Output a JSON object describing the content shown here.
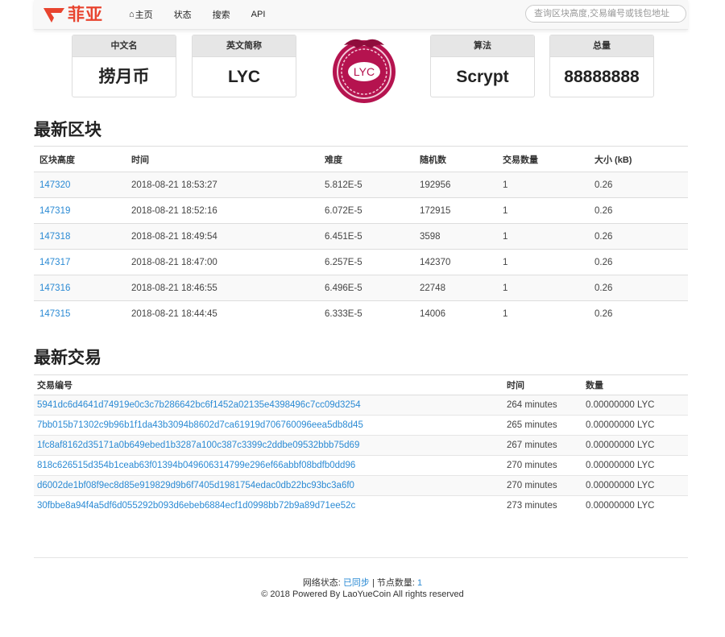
{
  "nav": {
    "brand": "菲亚",
    "items": [
      "主页",
      "状态",
      "搜索",
      "API"
    ],
    "search_placeholder": "查询区块高度,交易编号或钱包地址"
  },
  "cards": [
    {
      "label": "中文名",
      "value": "捞月币"
    },
    {
      "label": "英文简称",
      "value": "LYC"
    },
    {
      "label": "算法",
      "value": "Scrypt"
    },
    {
      "label": "总量",
      "value": "88888888"
    }
  ],
  "logo_text": "LYC",
  "blocks": {
    "title": "最新区块",
    "headers": [
      "区块高度",
      "时间",
      "难度",
      "随机数",
      "交易数量",
      "大小 (kB)"
    ],
    "rows": [
      [
        "147320",
        "2018-08-21 18:53:27",
        "5.812E-5",
        "192956",
        "1",
        "0.26"
      ],
      [
        "147319",
        "2018-08-21 18:52:16",
        "6.072E-5",
        "172915",
        "1",
        "0.26"
      ],
      [
        "147318",
        "2018-08-21 18:49:54",
        "6.451E-5",
        "3598",
        "1",
        "0.26"
      ],
      [
        "147317",
        "2018-08-21 18:47:00",
        "6.257E-5",
        "142370",
        "1",
        "0.26"
      ],
      [
        "147316",
        "2018-08-21 18:46:55",
        "6.496E-5",
        "22748",
        "1",
        "0.26"
      ],
      [
        "147315",
        "2018-08-21 18:44:45",
        "6.333E-5",
        "14006",
        "1",
        "0.26"
      ]
    ]
  },
  "transactions": {
    "title": "最新交易",
    "headers": [
      "交易编号",
      "时间",
      "数量"
    ],
    "rows": [
      [
        "5941dc6d4641d74919e0c3c7b286642bc6f1452a02135e4398496c7cc09d3254",
        "264 minutes",
        "0.00000000 LYC"
      ],
      [
        "7bb015b71302c9b96b1f1da43b3094b8602d7ca61919d706760096eea5db8d45",
        "265 minutes",
        "0.00000000 LYC"
      ],
      [
        "1fc8af8162d35171a0b649ebed1b3287a100c387c3399c2ddbe09532bbb75d69",
        "267 minutes",
        "0.00000000 LYC"
      ],
      [
        "818c626515d354b1ceab63f01394b049606314799e296ef66abbf08bdfb0dd96",
        "270 minutes",
        "0.00000000 LYC"
      ],
      [
        "d6002de1bf08f9ec8d85e919829d9b6f7405d1981754edac0db22bc93bc3a6f0",
        "270 minutes",
        "0.00000000 LYC"
      ],
      [
        "30fbbe8a94f4a5df6d055292b093d6ebeb6884ecf1d0998bb72b9a89d71ee52c",
        "273 minutes",
        "0.00000000 LYC"
      ]
    ]
  },
  "footer": {
    "status_label": "网络状态:",
    "status_value": "已同步",
    "separator": "|",
    "nodes_label": "节点数量:",
    "nodes_value": "1",
    "copyright": "© 2018 Powered By LaoYueCoin All rights reserved"
  },
  "colors": {
    "brand": "#e8442f",
    "link": "#2a8ad4",
    "logo": "#b5134f"
  }
}
